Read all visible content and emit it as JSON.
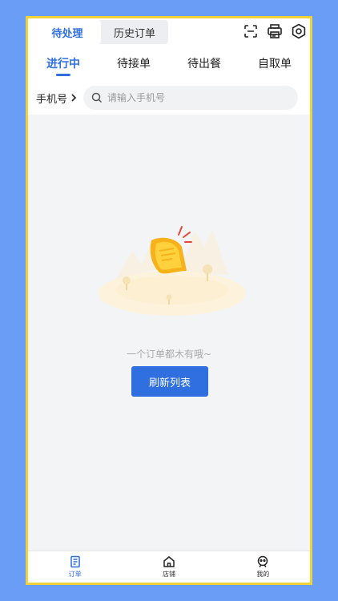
{
  "header": {
    "segments": [
      {
        "label": "待处理",
        "active": true
      },
      {
        "label": "历史订单",
        "active": false
      }
    ],
    "icons": [
      "scan-icon",
      "printer-icon",
      "settings-icon"
    ]
  },
  "tabs": [
    {
      "label": "进行中",
      "active": true
    },
    {
      "label": "待接单",
      "active": false
    },
    {
      "label": "待出餐",
      "active": false
    },
    {
      "label": "自取单",
      "active": false
    }
  ],
  "search": {
    "filter_label": "手机号",
    "placeholder": "请输入手机号",
    "value": ""
  },
  "empty": {
    "message": "一个订单都木有哦~",
    "refresh_label": "刷新列表"
  },
  "bottom_nav": [
    {
      "label": "订单",
      "icon": "order-icon",
      "active": true
    },
    {
      "label": "店铺",
      "icon": "shop-icon",
      "active": false
    },
    {
      "label": "我的",
      "icon": "profile-icon",
      "active": false
    }
  ],
  "colors": {
    "accent": "#2f6fe0",
    "background": "#6a9df5",
    "frame": "#f2d23a"
  }
}
